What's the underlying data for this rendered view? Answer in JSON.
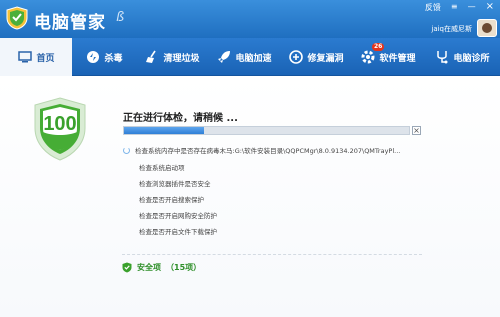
{
  "app": {
    "title": "电脑管家",
    "title_mark": "ß",
    "brand_color": "#2b7bd0"
  },
  "window": {
    "feedback_label": "反馈",
    "menu_label": "≡",
    "minimize_label": "—",
    "close_label": "×"
  },
  "user": {
    "name": "jaiq在威尼斯"
  },
  "nav": {
    "items": [
      {
        "label": "首页",
        "icon": "home-icon"
      },
      {
        "label": "杀毒",
        "icon": "antivirus-icon"
      },
      {
        "label": "清理垃圾",
        "icon": "broom-icon"
      },
      {
        "label": "电脑加速",
        "icon": "rocket-icon"
      },
      {
        "label": "修复漏洞",
        "icon": "patch-icon"
      },
      {
        "label": "软件管理",
        "icon": "software-icon",
        "badge": "26"
      },
      {
        "label": "电脑诊所",
        "icon": "clinic-icon"
      }
    ]
  },
  "scan": {
    "score": "100",
    "status_title": "正在进行体检，请稍候 ...",
    "progress": 0.28,
    "cancel_label": "×",
    "current_item": "检查系统内存中是否存在病毒木马:G:\\软件安装目录\\QQPCMgr\\8.0.9134.207\\QMTrayPl...",
    "checks": [
      "检查系统启动项",
      "检查浏览器插件是否安全",
      "检查是否开启搜索保护",
      "检查是否开启网购安全防护",
      "检查是否开启文件下载保护"
    ],
    "safe_label": "安全项",
    "safe_count": "（15项）"
  },
  "colors": {
    "shield_green": "#3aa12c",
    "safe_green": "#2f8f2a",
    "progress_blue": "#2f7fd6"
  }
}
